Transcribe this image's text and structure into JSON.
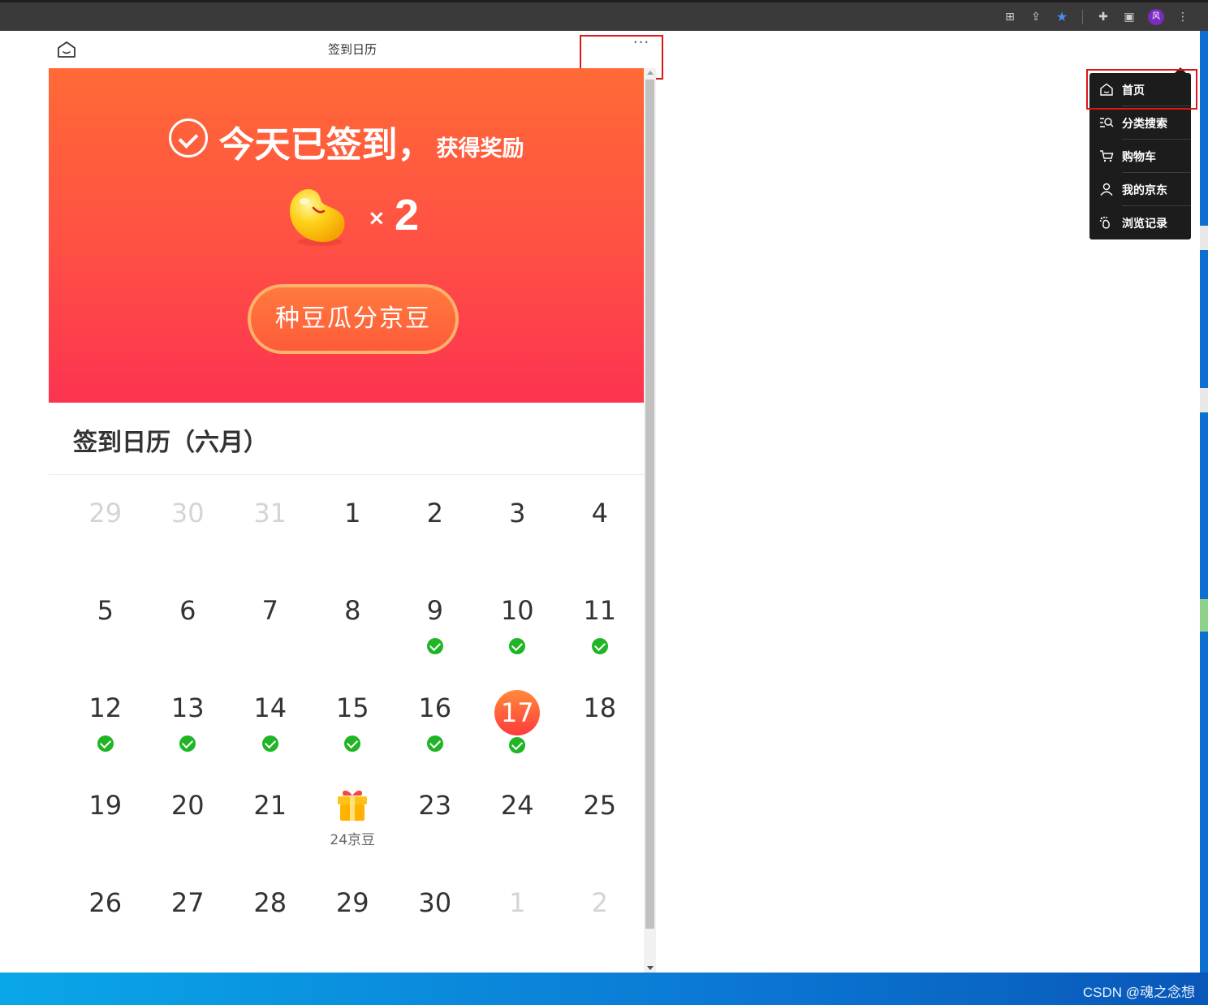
{
  "browser": {
    "icons": [
      "translate-icon",
      "share-icon",
      "bookmark-star-icon",
      "extensions-icon",
      "side-panel-icon"
    ],
    "profile_initial": "风"
  },
  "mobile_header": {
    "title": "签到日历",
    "more": "···"
  },
  "banner": {
    "signed_text": "今天已签到，",
    "reward_text": "获得奖励",
    "times": "×",
    "bean_count": "2",
    "button_label": "种豆瓜分京豆"
  },
  "calendar": {
    "title": "签到日历（六月）",
    "weeks": [
      [
        {
          "n": "29",
          "other": true
        },
        {
          "n": "30",
          "other": true
        },
        {
          "n": "31",
          "other": true
        },
        {
          "n": "1"
        },
        {
          "n": "2"
        },
        {
          "n": "3"
        },
        {
          "n": "4"
        }
      ],
      [
        {
          "n": "5"
        },
        {
          "n": "6"
        },
        {
          "n": "7"
        },
        {
          "n": "8"
        },
        {
          "n": "9",
          "signed": true
        },
        {
          "n": "10",
          "signed": true
        },
        {
          "n": "11",
          "signed": true
        }
      ],
      [
        {
          "n": "12",
          "signed": true
        },
        {
          "n": "13",
          "signed": true
        },
        {
          "n": "14",
          "signed": true
        },
        {
          "n": "15",
          "signed": true
        },
        {
          "n": "16",
          "signed": true
        },
        {
          "n": "17",
          "signed": true,
          "today": true
        },
        {
          "n": "18"
        }
      ],
      [
        {
          "n": "19"
        },
        {
          "n": "20"
        },
        {
          "n": "21"
        },
        {
          "n": "",
          "gift": "24京豆"
        },
        {
          "n": "23"
        },
        {
          "n": "24"
        },
        {
          "n": "25"
        }
      ],
      [
        {
          "n": "26"
        },
        {
          "n": "27"
        },
        {
          "n": "28"
        },
        {
          "n": "29"
        },
        {
          "n": "30"
        },
        {
          "n": "1",
          "other": true
        },
        {
          "n": "2",
          "other": true
        }
      ]
    ]
  },
  "menu": {
    "items": [
      {
        "label": "首页",
        "icon": "home-icon"
      },
      {
        "label": "分类搜索",
        "icon": "category-search-icon"
      },
      {
        "label": "购物车",
        "icon": "cart-icon"
      },
      {
        "label": "我的京东",
        "icon": "user-icon"
      },
      {
        "label": "浏览记录",
        "icon": "footprint-icon"
      }
    ]
  },
  "watermark": "CSDN @魂之念想",
  "colors": {
    "banner_top": "#ff6a36",
    "banner_bottom": "#fc3350",
    "check_green": "#1fb524",
    "highlight_red": "#e01515",
    "menu_bg": "#1c1c1c"
  }
}
